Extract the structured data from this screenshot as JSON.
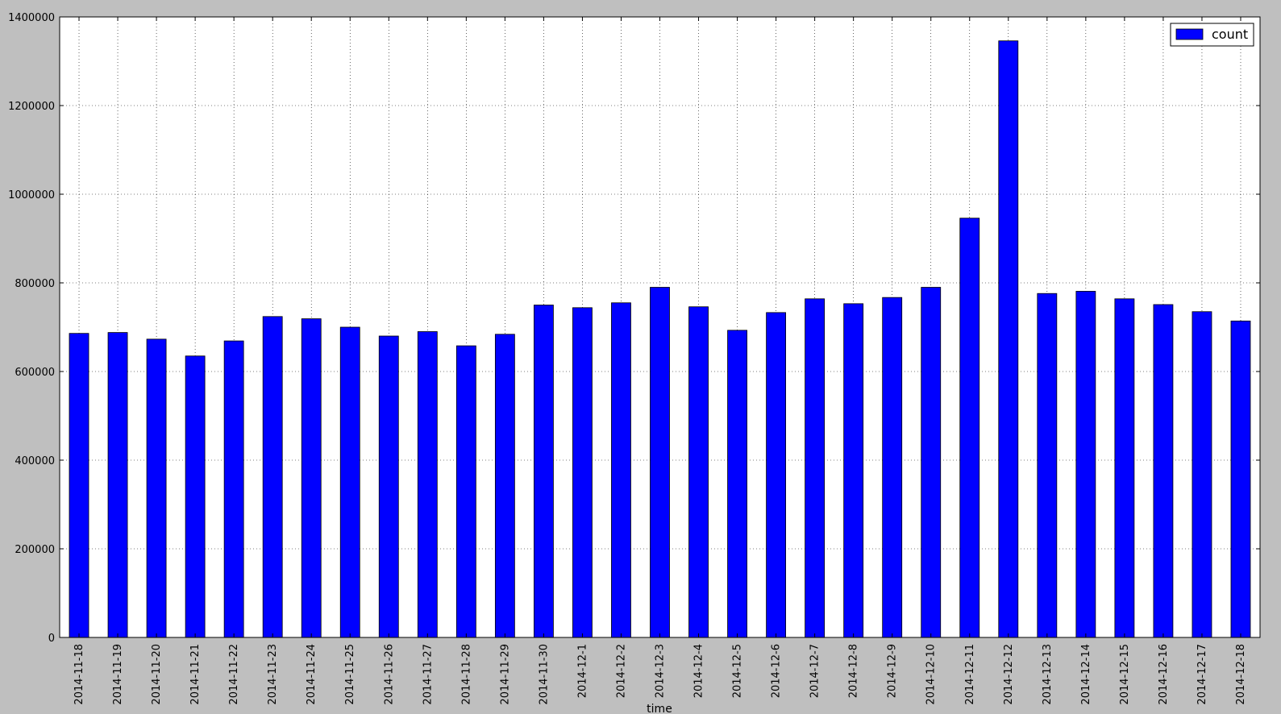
{
  "chart_data": {
    "type": "bar",
    "xlabel": "time",
    "ylabel": "",
    "ylim": [
      0,
      1400000
    ],
    "yticks": [
      0,
      200000,
      400000,
      600000,
      800000,
      1000000,
      1200000,
      1400000
    ],
    "grid": true,
    "legend_position": "top-right",
    "categories": [
      "2014-11-18",
      "2014-11-19",
      "2014-11-20",
      "2014-11-21",
      "2014-11-22",
      "2014-11-23",
      "2014-11-24",
      "2014-11-25",
      "2014-11-26",
      "2014-11-27",
      "2014-11-28",
      "2014-11-29",
      "2014-11-30",
      "2014-12-1",
      "2014-12-2",
      "2014-12-3",
      "2014-12-4",
      "2014-12-5",
      "2014-12-6",
      "2014-12-7",
      "2014-12-8",
      "2014-12-9",
      "2014-12-10",
      "2014-12-11",
      "2014-12-12",
      "2014-12-13",
      "2014-12-14",
      "2014-12-15",
      "2014-12-16",
      "2014-12-17",
      "2014-12-18"
    ],
    "series": [
      {
        "name": "count",
        "color": "#0000ff",
        "values": [
          686000,
          688000,
          673000,
          635000,
          669000,
          724000,
          719000,
          700000,
          680000,
          690000,
          658000,
          684000,
          750000,
          744000,
          755000,
          790000,
          746000,
          693000,
          733000,
          764000,
          753000,
          767000,
          790000,
          946000,
          1346000,
          776000,
          781000,
          764000,
          751000,
          735000,
          714000
        ]
      }
    ]
  }
}
